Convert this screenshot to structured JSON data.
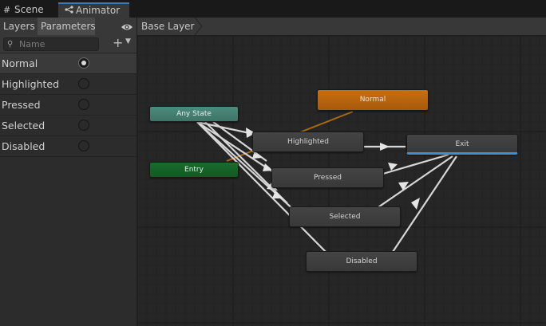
{
  "tabs": [
    {
      "label": "Scene",
      "icon": "grid-icon"
    },
    {
      "label": "Animator",
      "icon": "animator-icon"
    }
  ],
  "left_panel": {
    "subtabs": [
      "Layers",
      "Parameters"
    ],
    "search": {
      "placeholder": "Name"
    },
    "parameters": [
      {
        "label": "Normal",
        "value": true
      },
      {
        "label": "Highlighted",
        "value": false
      },
      {
        "label": "Pressed",
        "value": false
      },
      {
        "label": "Selected",
        "value": false
      },
      {
        "label": "Disabled",
        "value": false
      }
    ]
  },
  "graph": {
    "breadcrumb": "Base Layer",
    "states": {
      "any_state": "Any State",
      "entry": "Entry",
      "normal": "Normal",
      "highlighted": "Highlighted",
      "pressed": "Pressed",
      "selected": "Selected",
      "disabled": "Disabled",
      "exit": "Exit"
    },
    "colors": {
      "any_state": "#4b8b7d",
      "entry": "#1a6c2d",
      "default_state": "#c76f13",
      "exit_marker": "#3a8fd6",
      "transition": "#d6d6d6",
      "default_transition": "#a86a0a"
    }
  }
}
